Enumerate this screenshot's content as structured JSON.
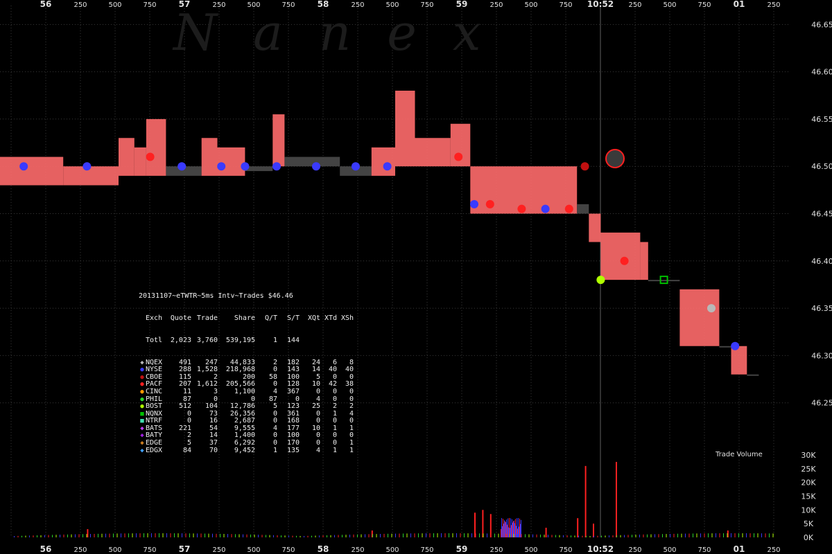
{
  "watermark": "Nanex",
  "stats_title": "20131107~eTWTR~5ms Intv~Trades $46.46",
  "stats_header": [
    "Exch",
    "Quote",
    "Trade",
    "Share",
    "Q/T",
    "S/T",
    "XQt",
    "XTd",
    "XSh"
  ],
  "stats_total": [
    "Totl",
    "2,023",
    "3,760",
    "539,195",
    "1",
    "144",
    "",
    "",
    ""
  ],
  "stats_rows": [
    {
      "exch": "NQEX",
      "quote": "491",
      "trade": "247",
      "share": "44,833",
      "qt": "2",
      "st": "182",
      "xqt": "24",
      "xtd": "6",
      "xsh": "8",
      "color": "#b8b8b8",
      "glyph": "◆"
    },
    {
      "exch": "NYSE",
      "quote": "288",
      "trade": "1,528",
      "share": "218,968",
      "qt": "0",
      "st": "143",
      "xqt": "14",
      "xtd": "40",
      "xsh": "40",
      "color": "#3a3aff",
      "glyph": "●"
    },
    {
      "exch": "CBOE",
      "quote": "115",
      "trade": "2",
      "share": "200",
      "qt": "58",
      "st": "100",
      "xqt": "5",
      "xtd": "0",
      "xsh": "0",
      "color": "#c01010",
      "glyph": "●"
    },
    {
      "exch": "PACF",
      "quote": "207",
      "trade": "1,612",
      "share": "205,566",
      "qt": "0",
      "st": "128",
      "xqt": "10",
      "xtd": "42",
      "xsh": "38",
      "color": "#ff2020",
      "glyph": "●"
    },
    {
      "exch": "CINC",
      "quote": "11",
      "trade": "3",
      "share": "1,100",
      "qt": "4",
      "st": "367",
      "xqt": "0",
      "xtd": "0",
      "xsh": "0",
      "color": "#ff9a00",
      "glyph": "●"
    },
    {
      "exch": "PHIL",
      "quote": "87",
      "trade": "0",
      "share": "0",
      "qt": "87",
      "st": "0",
      "xqt": "4",
      "xtd": "0",
      "xsh": "0",
      "color": "#2ad52a",
      "glyph": "●"
    },
    {
      "exch": "BOST",
      "quote": "512",
      "trade": "104",
      "share": "12,786",
      "qt": "5",
      "st": "123",
      "xqt": "25",
      "xtd": "2",
      "xsh": "2",
      "color": "#b0ff00",
      "glyph": "●"
    },
    {
      "exch": "NQNX",
      "quote": "0",
      "trade": "73",
      "share": "26,356",
      "qt": "0",
      "st": "361",
      "xqt": "0",
      "xtd": "1",
      "xsh": "4",
      "color": "#00c000",
      "glyph": "■"
    },
    {
      "exch": "NTRF",
      "quote": "0",
      "trade": "16",
      "share": "2,687",
      "qt": "0",
      "st": "168",
      "xqt": "0",
      "xtd": "0",
      "xsh": "0",
      "color": "#40e0b0",
      "glyph": "■"
    },
    {
      "exch": "BATS",
      "quote": "221",
      "trade": "54",
      "share": "9,555",
      "qt": "4",
      "st": "177",
      "xqt": "10",
      "xtd": "1",
      "xsh": "1",
      "color": "#c040ff",
      "glyph": "◆"
    },
    {
      "exch": "BATY",
      "quote": "2",
      "trade": "14",
      "share": "1,400",
      "qt": "0",
      "st": "100",
      "xqt": "0",
      "xtd": "0",
      "xsh": "0",
      "color": "#a020e0",
      "glyph": "◆"
    },
    {
      "exch": "EDGE",
      "quote": "5",
      "trade": "37",
      "share": "6,292",
      "qt": "0",
      "st": "170",
      "xqt": "0",
      "xtd": "0",
      "xsh": "1",
      "color": "#d08020",
      "glyph": "◆"
    },
    {
      "exch": "EDGX",
      "quote": "84",
      "trade": "70",
      "share": "9,452",
      "qt": "1",
      "st": "135",
      "xqt": "4",
      "xtd": "1",
      "xsh": "1",
      "color": "#40a0ff",
      "glyph": "◆"
    }
  ],
  "volume_label": "Trade Volume",
  "chart_data": {
    "type": "scatter",
    "x_ticks": [
      "56",
      "250",
      "500",
      "750",
      "57",
      "250",
      "500",
      "750",
      "58",
      "250",
      "500",
      "750",
      "59",
      "250",
      "500",
      "750",
      "10:52",
      "250",
      "500",
      "750",
      "01",
      "250"
    ],
    "y_ticks": [
      46.65,
      46.6,
      46.55,
      46.5,
      46.45,
      46.4,
      46.35,
      46.3,
      46.25
    ],
    "ylim": [
      46.2,
      46.67
    ],
    "volume_ticks": [
      "30K",
      "25K",
      "20K",
      "15K",
      "10K",
      "5K",
      "0K"
    ],
    "volume_ylim": [
      0,
      30000
    ],
    "grid": true,
    "nbbo": [
      {
        "x": 0.0,
        "bid": 46.48,
        "ask": 46.51
      },
      {
        "x": 0.08,
        "bid": 46.48,
        "ask": 46.5
      },
      {
        "x": 0.15,
        "bid": 46.49,
        "ask": 46.53
      },
      {
        "x": 0.17,
        "bid": 46.49,
        "ask": 46.52
      },
      {
        "x": 0.185,
        "bid": 46.49,
        "ask": 46.55
      },
      {
        "x": 0.21,
        "bid": 46.49,
        "ask": 46.5
      },
      {
        "x": 0.25,
        "bid": 46.49,
        "ask": 46.5
      },
      {
        "x": 0.255,
        "bid": 46.49,
        "ask": 46.53
      },
      {
        "x": 0.275,
        "bid": 46.49,
        "ask": 46.52
      },
      {
        "x": 0.31,
        "bid": 46.495,
        "ask": 46.5
      },
      {
        "x": 0.345,
        "bid": 46.5,
        "ask": 46.555
      },
      {
        "x": 0.36,
        "bid": 46.5,
        "ask": 46.51
      },
      {
        "x": 0.43,
        "bid": 46.49,
        "ask": 46.5
      },
      {
        "x": 0.47,
        "bid": 46.49,
        "ask": 46.52
      },
      {
        "x": 0.5,
        "bid": 46.5,
        "ask": 46.58
      },
      {
        "x": 0.525,
        "bid": 46.5,
        "ask": 46.53
      },
      {
        "x": 0.57,
        "bid": 46.5,
        "ask": 46.545
      },
      {
        "x": 0.595,
        "bid": 46.45,
        "ask": 46.5
      },
      {
        "x": 0.73,
        "bid": 46.45,
        "ask": 46.46
      },
      {
        "x": 0.745,
        "bid": 46.42,
        "ask": 46.45
      },
      {
        "x": 0.76,
        "bid": 46.38,
        "ask": 46.43
      },
      {
        "x": 0.81,
        "bid": 46.38,
        "ask": 46.42
      },
      {
        "x": 0.82,
        "bid": 46.38,
        "ask": 46.38
      },
      {
        "x": 0.86,
        "bid": 46.31,
        "ask": 46.37
      },
      {
        "x": 0.91,
        "bid": 46.31,
        "ask": 46.31
      },
      {
        "x": 0.925,
        "bid": 46.28,
        "ask": 46.31
      },
      {
        "x": 0.945,
        "bid": 46.28,
        "ask": 46.28
      }
    ],
    "trades": [
      {
        "x": 0.03,
        "y": 46.5,
        "exch": "NYSE"
      },
      {
        "x": 0.11,
        "y": 46.5,
        "exch": "NYSE"
      },
      {
        "x": 0.19,
        "y": 46.51,
        "exch": "PACF"
      },
      {
        "x": 0.23,
        "y": 46.5,
        "exch": "NYSE"
      },
      {
        "x": 0.28,
        "y": 46.5,
        "exch": "NYSE"
      },
      {
        "x": 0.31,
        "y": 46.5,
        "exch": "NYSE"
      },
      {
        "x": 0.35,
        "y": 46.5,
        "exch": "NYSE"
      },
      {
        "x": 0.4,
        "y": 46.5,
        "exch": "NYSE"
      },
      {
        "x": 0.45,
        "y": 46.5,
        "exch": "NYSE"
      },
      {
        "x": 0.49,
        "y": 46.5,
        "exch": "NYSE"
      },
      {
        "x": 0.58,
        "y": 46.51,
        "exch": "PACF"
      },
      {
        "x": 0.6,
        "y": 46.46,
        "exch": "NYSE"
      },
      {
        "x": 0.62,
        "y": 46.46,
        "exch": "PACF"
      },
      {
        "x": 0.66,
        "y": 46.455,
        "exch": "PACF"
      },
      {
        "x": 0.69,
        "y": 46.455,
        "exch": "NYSE"
      },
      {
        "x": 0.72,
        "y": 46.455,
        "exch": "PACF"
      },
      {
        "x": 0.74,
        "y": 46.5,
        "exch": "CBOE"
      },
      {
        "x": 0.76,
        "y": 46.38,
        "exch": "BOST"
      },
      {
        "x": 0.79,
        "y": 46.4,
        "exch": "PACF"
      },
      {
        "x": 0.84,
        "y": 46.38,
        "exch": "NQNX"
      },
      {
        "x": 0.9,
        "y": 46.35,
        "exch": "NQEX"
      },
      {
        "x": 0.93,
        "y": 46.31,
        "exch": "NYSE"
      }
    ],
    "volume": [
      {
        "x": 0.6,
        "v": 9000
      },
      {
        "x": 0.61,
        "v": 10000
      },
      {
        "x": 0.62,
        "v": 8500
      },
      {
        "x": 0.74,
        "v": 26000
      },
      {
        "x": 0.73,
        "v": 7000
      },
      {
        "x": 0.75,
        "v": 5000
      },
      {
        "x": 0.11,
        "v": 3000
      },
      {
        "x": 0.47,
        "v": 2500
      },
      {
        "x": 0.69,
        "v": 3500
      },
      {
        "x": 0.92,
        "v": 2500
      }
    ]
  }
}
